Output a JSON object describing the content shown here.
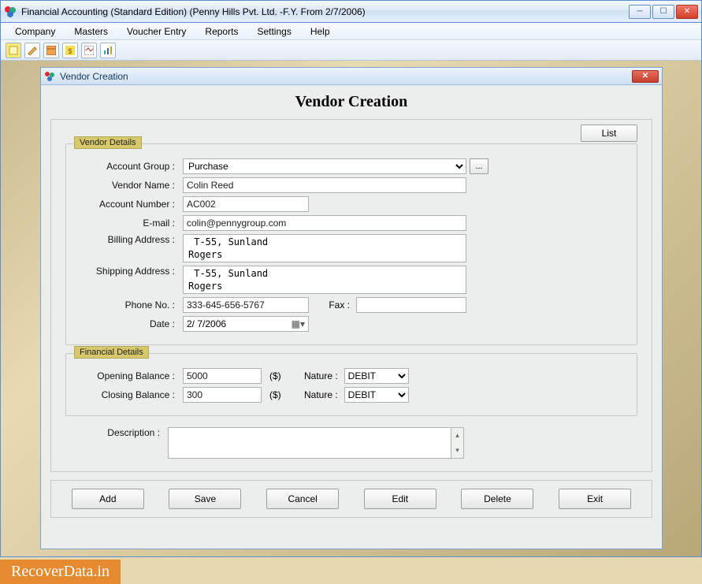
{
  "window": {
    "title": "Financial Accounting (Standard Edition) (Penny Hills Pvt. Ltd. -F.Y. From 2/7/2006)"
  },
  "menu": [
    "Company",
    "Masters",
    "Voucher Entry",
    "Reports",
    "Settings",
    "Help"
  ],
  "inner": {
    "title": "Vendor Creation",
    "page_title": "Vendor Creation",
    "list_btn": "List"
  },
  "vendor_group": {
    "legend": "Vendor Details",
    "labels": {
      "account_group": "Account Group :",
      "vendor_name": "Vendor Name :",
      "account_number": "Account Number :",
      "email": "E-mail :",
      "billing": "Billing Address :",
      "shipping": "Shipping Address :",
      "phone": "Phone No. :",
      "fax": "Fax :",
      "date": "Date :"
    },
    "values": {
      "account_group": "Purchase",
      "vendor_name": "Colin Reed",
      "account_number": "AC002",
      "email": "colin@pennygroup.com",
      "billing": " T-55, Sunland\nRogers",
      "shipping": " T-55, Sunland\nRogers",
      "phone": "333-645-656-5767",
      "fax": "",
      "date": "2/ 7/2006"
    }
  },
  "financial_group": {
    "legend": "Financial Details",
    "labels": {
      "opening": "Opening Balance :",
      "closing": "Closing Balance :",
      "nature": "Nature :",
      "currency": "($)"
    },
    "values": {
      "opening": "5000",
      "closing": "300",
      "nature_open": "DEBIT",
      "nature_close": "DEBIT"
    }
  },
  "description": {
    "label": "Description :",
    "value": ""
  },
  "buttons": [
    "Add",
    "Save",
    "Cancel",
    "Edit",
    "Delete",
    "Exit"
  ],
  "watermark": "RecoverData.in",
  "dots": "..."
}
